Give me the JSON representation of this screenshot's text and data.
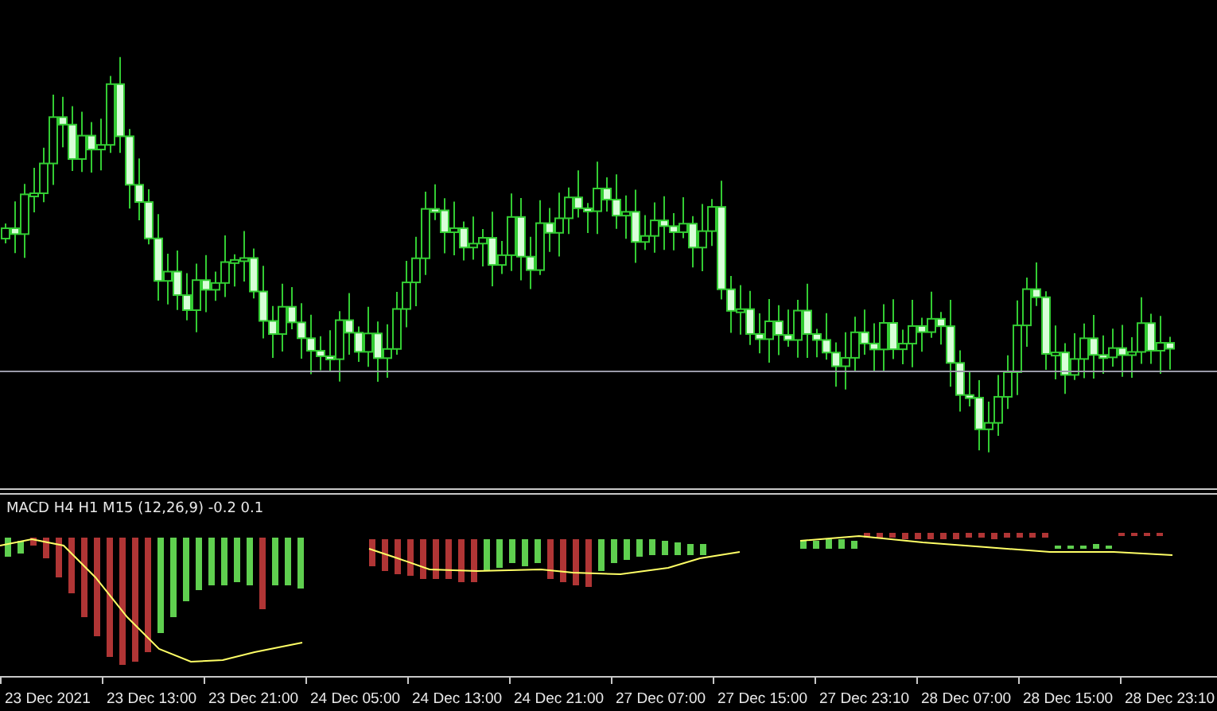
{
  "macd_panel": {
    "label": "MACD H4 H1 M15 (12,26,9) -0.2 0.1"
  },
  "time_axis": {
    "labels": [
      "23 Dec 2021",
      "23 Dec 13:00",
      "23 Dec 21:00",
      "24 Dec 05:00",
      "24 Dec 13:00",
      "24 Dec 21:00",
      "27 Dec 07:00",
      "27 Dec 15:00",
      "27 Dec 23:10",
      "28 Dec 07:00",
      "28 Dec 15:00",
      "28 Dec 23:10"
    ]
  }
}
